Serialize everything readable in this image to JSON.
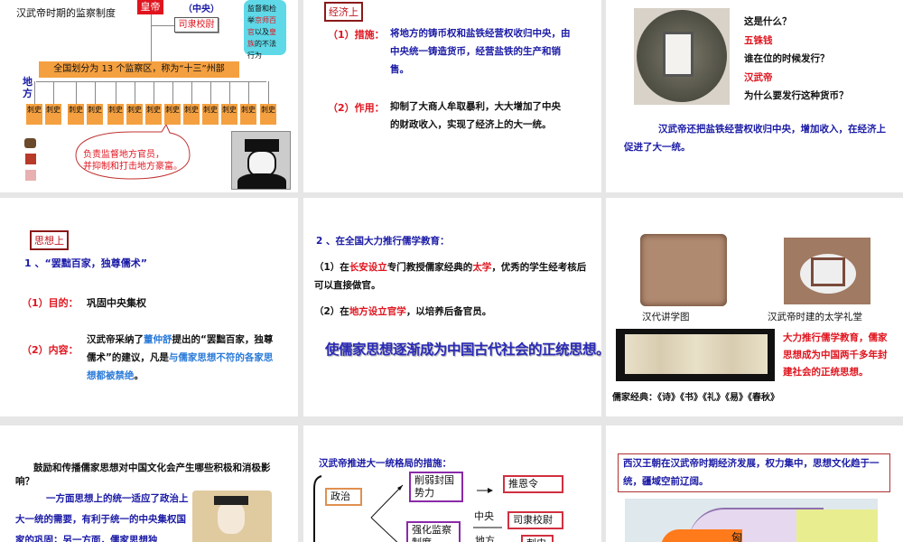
{
  "slide1": {
    "title": "汉武帝时期的监察制度",
    "emperor": "皇帝",
    "central": "（中央）",
    "sili": "司隶校尉",
    "note_parts": [
      "监督和检举",
      "京师百官",
      "以及",
      "皇族",
      "的不法行为"
    ],
    "banner": "全国划分为 13 个监察区，称为“十三”州部",
    "local": "地方",
    "cishi": [
      "刺史",
      "刺史",
      "刺史",
      "刺史",
      "刺史",
      "刺史",
      "刺史",
      "刺史",
      "刺史",
      "刺史",
      "刺史",
      "刺史",
      "刺史"
    ],
    "bubble_line1": "负责监督地方官员，",
    "bubble_line2": "并抑制和打击地方豪富。"
  },
  "slide2": {
    "tag": "经济上",
    "item1_label": "（1）措施：",
    "item1_text": "将地方的铸币权和盐铁经营权收归中央，由中央统一铸造货币，经营盐铁的生产和销售。",
    "item2_label": "（2）作用：",
    "item2_text": "抑制了大商人牟取暴利，大大增加了中央的财政收入，实现了经济上的大一统。"
  },
  "slide3": {
    "qa": [
      "这是什么？",
      "五铢钱",
      "谁在位的时候发行？",
      "汉武帝",
      "为什么要发行这种货币？"
    ],
    "summary": "汉武帝还把盐铁经营权收归中央，增加收入，在经济上促进了大一统。"
  },
  "slide4": {
    "tag": "思想上",
    "heading": "1 、“罢黜百家，独尊儒术”",
    "item1_label": "（1）目的：",
    "item1_text": "巩固中央集权",
    "item2_label": "（2）内容：",
    "item2_parts": [
      "汉武帝采纳了",
      "董仲舒",
      "提出的“罢黜百家，独尊儒术”的建议，凡是",
      "与儒家思想不符的各家思想都被禁绝",
      "。"
    ]
  },
  "slide5": {
    "heading": "2 、在全国大力推行儒学教育：",
    "item1_parts": [
      "（1）在",
      "长安设立",
      "专门教授儒家经典的",
      "太学",
      "，优秀的学生经考核后可以直接做官。"
    ],
    "item2_parts": [
      "（2）在",
      "地方设立官学",
      "，以培养后备官员。"
    ],
    "banner": "使儒家思想逐渐成为中国古代社会的正统思想。"
  },
  "slide6": {
    "caption1": "汉代讲学图",
    "caption2": "汉武帝时建的太学礼堂",
    "red_text": "大力推行儒学教育，儒家思想成为中国两千多年封建社会的正统思想。",
    "classics": "儒家经典：《诗》《书》《礼》《易》《春秋》"
  },
  "slide7": {
    "question": "鼓励和传播儒家思想对中国文化会产生哪些积极和消极影响？",
    "answer": "一方面思想上的统一适应了政治上大一统的需要，有利于统一的中央集权国家的巩固；另一方面，儒家思想独"
  },
  "slide8": {
    "title": "汉武帝推进大一统格局的措施：",
    "politics": "政治",
    "weaken": "削弱封国势力",
    "tuien": "推恩令",
    "central": "中央",
    "sili": "司隶校尉",
    "supervise": "强化监察制度",
    "local": "地方",
    "cishi": "刺史"
  },
  "slide9": {
    "summary": "西汉王朝在汉武帝时期经济发展，权力集中，思想文化趋于一统，疆域空前辽阔。",
    "map_label": "匈"
  }
}
